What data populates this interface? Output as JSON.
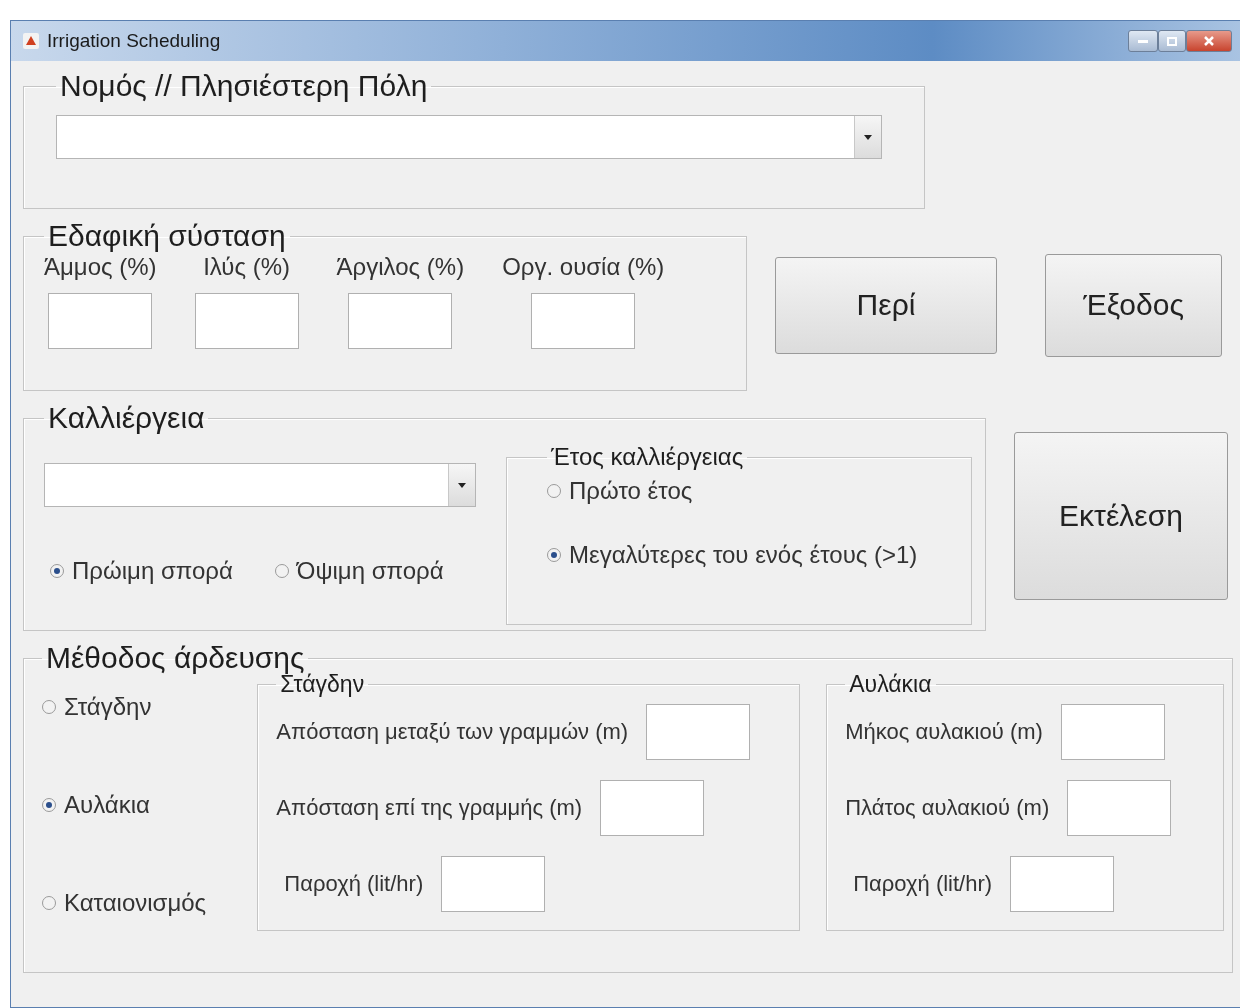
{
  "window": {
    "title": "Irrigation Scheduling"
  },
  "location": {
    "legend": "Νομός // Πλησιέστερη Πόλη"
  },
  "soil": {
    "legend": "Εδαφική σύσταση",
    "fields": [
      {
        "label": "Άμμος (%)"
      },
      {
        "label": "Ιλύς (%)"
      },
      {
        "label": "Άργιλος (%)"
      },
      {
        "label": "Οργ. ουσία (%)"
      }
    ]
  },
  "buttons": [
    {
      "label": "Περί"
    },
    {
      "label": "Έξοδος"
    }
  ],
  "crop": {
    "legend": "Καλλιέργεια",
    "sowing": [
      {
        "label": "Πρώιμη σπορά",
        "selected": true
      },
      {
        "label": "Όψιμη σπορά",
        "selected": false
      }
    ],
    "year": {
      "legend": "Έτος καλλιέργειας",
      "options": [
        {
          "label": "Πρώτο έτος",
          "selected": false
        },
        {
          "label": "Μεγαλύτερες του ενός έτους (>1)",
          "selected": true
        }
      ]
    }
  },
  "run_button": {
    "label": "Εκτέλεση"
  },
  "irrigation": {
    "legend": "Μέθοδος άρδευσης",
    "methods": [
      {
        "label": "Στάγδην",
        "selected": false
      },
      {
        "label": "Αυλάκια",
        "selected": true
      },
      {
        "label": "Καταιονισμός",
        "selected": false
      }
    ],
    "panels": [
      {
        "legend": "Στάγδην",
        "fields": [
          {
            "label": "Απόσταση μεταξύ  των γραμμών (m)"
          },
          {
            "label": "Απόσταση επί της γραμμής (m)"
          },
          {
            "label": "Παροχή  (lit/hr)"
          }
        ]
      },
      {
        "legend": "Αυλάκια",
        "fields": [
          {
            "label": "Μήκος αυλακιού (m)"
          },
          {
            "label": "Πλάτος αυλακιού (m)"
          },
          {
            "label": "Παροχή  (lit/hr)"
          }
        ]
      }
    ]
  }
}
